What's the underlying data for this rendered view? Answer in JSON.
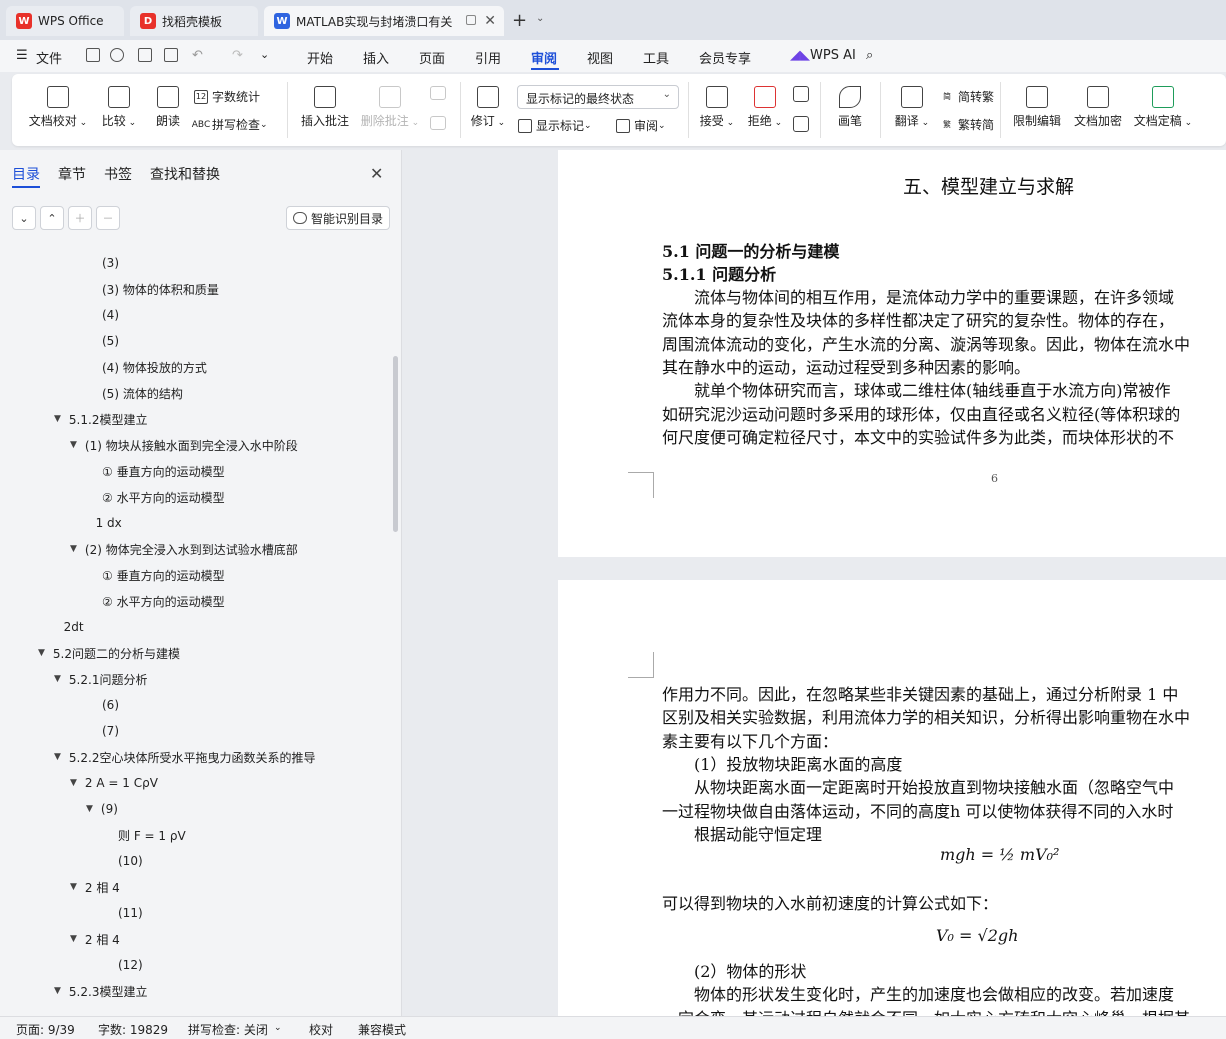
{
  "tabs": [
    {
      "label": "WPS Office",
      "icon": "wps-logo-icon"
    },
    {
      "label": "找稻壳模板",
      "icon": "docer-icon"
    },
    {
      "label": "MATLAB实现与封堵溃口有关",
      "icon": "word-doc-icon"
    }
  ],
  "menu": {
    "file": "文件",
    "items": [
      "开始",
      "插入",
      "页面",
      "引用",
      "审阅",
      "视图",
      "工具",
      "会员专享"
    ],
    "active": "审阅",
    "wps_ai": "WPS AI"
  },
  "ribbon": {
    "proofread": "文档校对",
    "compare": "比较",
    "read_aloud": "朗读",
    "word_count": "字数统计",
    "spell_check": "拼写检查",
    "insert_comment": "插入批注",
    "delete_comment": "删除批注",
    "track_changes": "修订",
    "markup_state": "显示标记的最终状态",
    "show_markup": "显示标记",
    "review_pane": "审阅",
    "accept": "接受",
    "reject": "拒绝",
    "ink": "画笔",
    "translate": "翻译",
    "to_traditional": "简转繁",
    "to_simplified": "繁转简",
    "restrict_edit": "限制编辑",
    "encrypt": "文档加密",
    "finalize": "文档定稿"
  },
  "nav": {
    "tabs": [
      "目录",
      "章节",
      "书签",
      "查找和替换"
    ],
    "smart_toc": "智能识别目录",
    "toc": [
      {
        "text": "(3)",
        "level": 3,
        "arrow": false
      },
      {
        "text": "(3) 物体的体积和质量",
        "level": 3,
        "arrow": false
      },
      {
        "text": "(4)",
        "level": 3,
        "arrow": false
      },
      {
        "text": "(5)",
        "level": 3,
        "arrow": false
      },
      {
        "text": "(4) 物体投放的方式",
        "level": 3,
        "arrow": false
      },
      {
        "text": "(5) 流体的结构",
        "level": 3,
        "arrow": false
      },
      {
        "text": "5.1.2模型建立",
        "level": 1,
        "arrow": true
      },
      {
        "text": "(1) 物块从接触水面到完全浸入水中阶段",
        "level": 2,
        "arrow": true
      },
      {
        "text": "① 垂直方向的运动模型",
        "level": 3,
        "arrow": false
      },
      {
        "text": "② 水平方向的运动模型",
        "level": 3,
        "arrow": false
      },
      {
        "text": "1 dx",
        "level": 2.6,
        "arrow": false
      },
      {
        "text": "(2) 物体完全浸入水到到达试验水槽底部",
        "level": 2,
        "arrow": true
      },
      {
        "text": "① 垂直方向的运动模型",
        "level": 3,
        "arrow": false
      },
      {
        "text": "② 水平方向的运动模型",
        "level": 3,
        "arrow": false
      },
      {
        "text": "2dt",
        "level": 0.6,
        "arrow": false
      },
      {
        "text": "5.2问题二的分析与建模",
        "level": 0,
        "arrow": true
      },
      {
        "text": "5.2.1问题分析",
        "level": 1,
        "arrow": true
      },
      {
        "text": "(6)",
        "level": 3,
        "arrow": false
      },
      {
        "text": "(7)",
        "level": 3,
        "arrow": false
      },
      {
        "text": "5.2.2空心块体所受水平拖曳力函数关系的推导",
        "level": 1,
        "arrow": true
      },
      {
        "text": "2 A = 1 CρV",
        "level": 2,
        "arrow": true
      },
      {
        "text": "(9)",
        "level": 3,
        "arrow": true
      },
      {
        "text": "则 F = 1 ρV",
        "level": 4,
        "arrow": false
      },
      {
        "text": "(10)",
        "level": 4,
        "arrow": false
      },
      {
        "text": "2 相  4",
        "level": 2,
        "arrow": true
      },
      {
        "text": "(11)",
        "level": 4,
        "arrow": false
      },
      {
        "text": "2 相 4",
        "level": 2,
        "arrow": true
      },
      {
        "text": "(12)",
        "level": 4,
        "arrow": false
      },
      {
        "text": "5.2.3模型建立",
        "level": 1,
        "arrow": true
      }
    ]
  },
  "document": {
    "page1": {
      "chapter_title": "五、模型建立与求解",
      "h2": "5.1 问题一的分析与建模",
      "h3": "5.1.1 问题分析",
      "lines": [
        "　　流体与物体间的相互作用，是流体动力学中的重要课题，在许多领域",
        "流体本身的复杂性及块体的多样性都决定了研究的复杂性。物体的存在，",
        "周围流体流动的变化，产生水流的分离、漩涡等现象。因此，物体在流水中",
        "其在静水中的运动，运动过程受到多种因素的影响。",
        "　　就单个物体研究而言，球体或二维柱体(轴线垂直于水流方向)常被作",
        "如研究泥沙运动问题时多采用的球形体，仅由直径或名义粒径(等体积球的",
        "何尺度便可确定粒径尺寸，本文中的实验试件多为此类，而块体形状的不"
      ],
      "page_number": "6"
    },
    "page2": {
      "lines_a": [
        "作用力不同。因此，在忽略某些非关键因素的基础上，通过分析附录 1 中",
        "区别及相关实验数据，利用流体力学的相关知识，分析得出影响重物在水中",
        "素主要有以下几个方面：",
        "　　(1）投放物块距离水面的高度",
        "　　从物块距离水面一定距离时开始投放直到物块接触水面（忽略空气中",
        "一过程物块做自由落体运动，不同的高度h 可以使物体获得不同的入水时",
        "　　根据动能守恒定理"
      ],
      "formula1": "mgh = ½ mV₀²",
      "line_b": "可以得到物块的入水前初速度的计算公式如下：",
      "formula2": "V₀ = √2gh",
      "lines_c": [
        "　　(2）物体的形状",
        "　　物体的形状发生变化时，产生的加速度也会做相应的改变。若加速度",
        "一定会变，其运动过程自然就会不同。如大实心方砖和大空心峰巢，根据其"
      ]
    }
  },
  "status": {
    "page": "页面: 9/39",
    "words": "字数: 19829",
    "spell": "拼写检查: 关闭",
    "proof": "校对",
    "compat": "兼容模式"
  }
}
